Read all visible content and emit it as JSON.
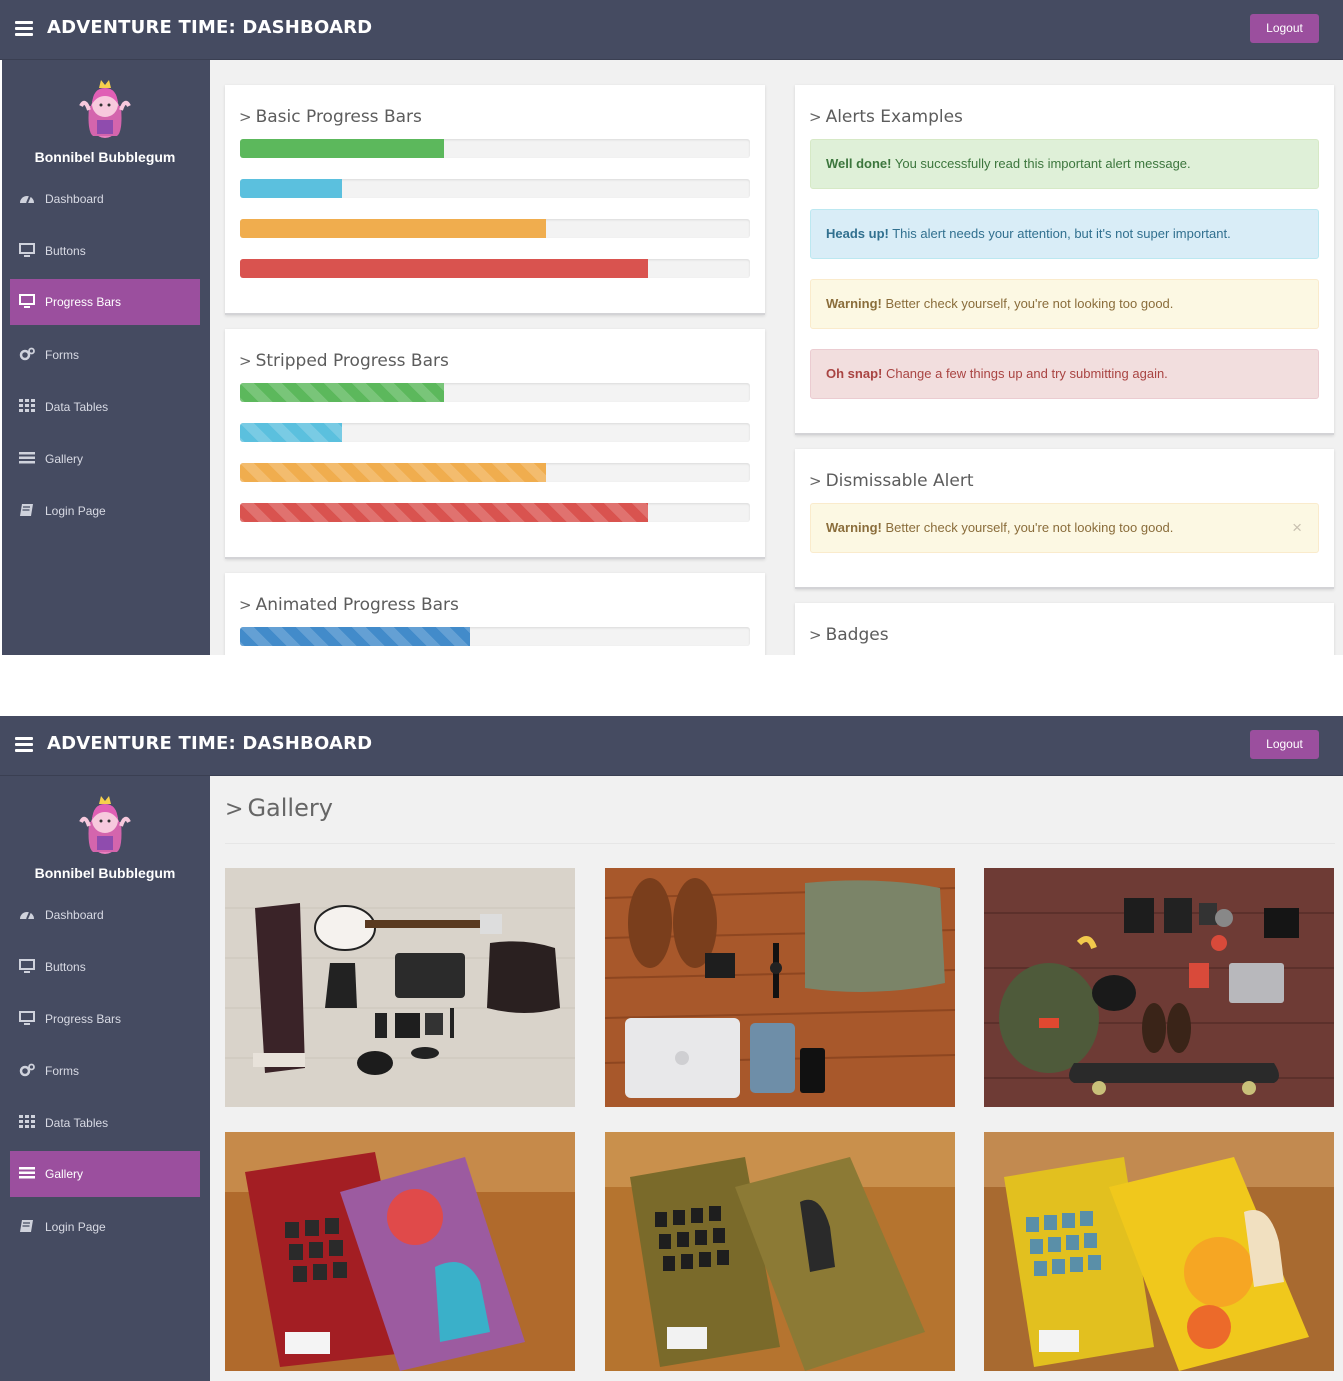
{
  "app": {
    "title": "ADVENTURE TIME: DASHBOARD",
    "logout_label": "Logout"
  },
  "user": {
    "name": "Bonnibel Bubblegum"
  },
  "nav": [
    {
      "label": "Dashboard",
      "icon": "dashboard-icon"
    },
    {
      "label": "Buttons",
      "icon": "monitor-icon"
    },
    {
      "label": "Progress Bars",
      "icon": "monitor-icon"
    },
    {
      "label": "Forms",
      "icon": "gears-icon"
    },
    {
      "label": "Data Tables",
      "icon": "grid-icon"
    },
    {
      "label": "Gallery",
      "icon": "list-icon"
    },
    {
      "label": "Login Page",
      "icon": "book-icon"
    }
  ],
  "screen_a": {
    "active_nav": "Progress Bars",
    "basic": {
      "title": "Basic Progress Bars",
      "bars": [
        {
          "type": "success",
          "percent": 40
        },
        {
          "type": "info",
          "percent": 20
        },
        {
          "type": "warning",
          "percent": 60
        },
        {
          "type": "danger",
          "percent": 80
        }
      ]
    },
    "striped": {
      "title": "Stripped Progress Bars",
      "bars": [
        {
          "type": "success",
          "percent": 40
        },
        {
          "type": "info",
          "percent": 20
        },
        {
          "type": "warning",
          "percent": 60
        },
        {
          "type": "danger",
          "percent": 80
        }
      ]
    },
    "animated": {
      "title": "Animated Progress Bars",
      "bars": [
        {
          "type": "primary",
          "percent": 45
        }
      ]
    },
    "alerts": {
      "title": "Alerts Examples",
      "items": [
        {
          "type": "success",
          "strong": "Well done!",
          "text": " You successfully read this important alert message."
        },
        {
          "type": "info",
          "strong": "Heads up!",
          "text": " This alert needs your attention, but it's not super important."
        },
        {
          "type": "warning",
          "strong": "Warning!",
          "text": " Better check yourself, you're not looking too good."
        },
        {
          "type": "danger",
          "strong": "Oh snap!",
          "text": " Change a few things up and try submitting again."
        }
      ]
    },
    "dismissable": {
      "title": "Dismissable Alert",
      "strong": "Warning!",
      "text": " Better check yourself, you're not looking too good.",
      "close_glyph": "×"
    },
    "badges": {
      "title": "Badges"
    }
  },
  "screen_b": {
    "active_nav": "Gallery",
    "page_title": "Gallery",
    "photos": [
      "flat-lay-guitar-jacket",
      "flat-lay-shoes-bag-laptop",
      "flat-lay-skateboard-backpack",
      "cali-free-books",
      "out-front-books",
      "marketing-miracles-books"
    ]
  },
  "colors": {
    "topbar": "#454b61",
    "sidebar": "#454b61",
    "accent": "#9b4f9e",
    "success": "#5cb85c",
    "info": "#5bc0de",
    "warning": "#f0ad4e",
    "danger": "#d9534f",
    "primary": "#428bca"
  }
}
